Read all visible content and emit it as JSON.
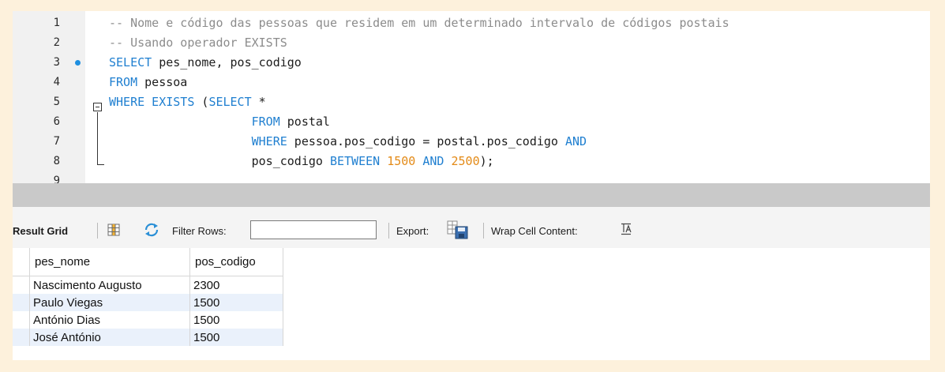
{
  "editor": {
    "lines": [
      {
        "n": "1",
        "tokens": [
          {
            "t": "cm",
            "v": "-- Nome e código das pessoas que residem em um determinado intervalo de códigos postais"
          }
        ]
      },
      {
        "n": "2",
        "tokens": [
          {
            "t": "cm",
            "v": "-- Usando operador EXISTS"
          }
        ]
      },
      {
        "n": "3",
        "tokens": [
          {
            "t": "kw",
            "v": "SELECT"
          },
          {
            "t": "tx",
            "v": " pes_nome, pos_codigo"
          }
        ]
      },
      {
        "n": "4",
        "tokens": [
          {
            "t": "kw",
            "v": "FROM"
          },
          {
            "t": "tx",
            "v": " pessoa"
          }
        ]
      },
      {
        "n": "5",
        "tokens": [
          {
            "t": "kw",
            "v": "WHERE EXISTS"
          },
          {
            "t": "tx",
            "v": " ("
          },
          {
            "t": "kw",
            "v": "SELECT"
          },
          {
            "t": "tx",
            "v": " *"
          }
        ]
      },
      {
        "n": "6",
        "tokens": [
          {
            "t": "tx",
            "v": "                    "
          },
          {
            "t": "kw",
            "v": "FROM"
          },
          {
            "t": "tx",
            "v": " postal"
          }
        ]
      },
      {
        "n": "7",
        "tokens": [
          {
            "t": "tx",
            "v": "                    "
          },
          {
            "t": "kw",
            "v": "WHERE"
          },
          {
            "t": "tx",
            "v": " pessoa.pos_codigo = postal.pos_codigo "
          },
          {
            "t": "kw",
            "v": "AND"
          }
        ]
      },
      {
        "n": "8",
        "tokens": [
          {
            "t": "tx",
            "v": "                    pos_codigo "
          },
          {
            "t": "kw",
            "v": "BETWEEN"
          },
          {
            "t": "tx",
            "v": " "
          },
          {
            "t": "num",
            "v": "1500"
          },
          {
            "t": "tx",
            "v": " "
          },
          {
            "t": "kw",
            "v": "AND"
          },
          {
            "t": "tx",
            "v": " "
          },
          {
            "t": "num",
            "v": "2500"
          },
          {
            "t": "tx",
            "v": ");"
          }
        ]
      },
      {
        "n": "9",
        "tokens": []
      }
    ],
    "active_line": "3"
  },
  "toolbar": {
    "result_grid_label": "Result Grid",
    "filter_rows_label": "Filter Rows:",
    "filter_value": "",
    "export_label": "Export:",
    "wrap_label": "Wrap Cell Content:"
  },
  "grid": {
    "columns": [
      "pes_nome",
      "pos_codigo"
    ],
    "rows": [
      [
        "Nascimento Augusto",
        "2300"
      ],
      [
        "Paulo Viegas",
        "1500"
      ],
      [
        "António Dias",
        "1500"
      ],
      [
        "José António",
        "1500"
      ]
    ]
  },
  "colors": {
    "keyword": "#1f7fd0",
    "comment": "#8c8c8c",
    "number": "#e38a17",
    "alt_row": "#eaf1fb",
    "background": "#fdf1dc"
  },
  "icons": {
    "grid": "grid-view-icon",
    "refresh": "refresh-icon",
    "export": "export-icon",
    "wrap": "wrap-cell-icon",
    "breakpoint": "statement-dot-icon",
    "fold": "collapse-fold-icon"
  }
}
